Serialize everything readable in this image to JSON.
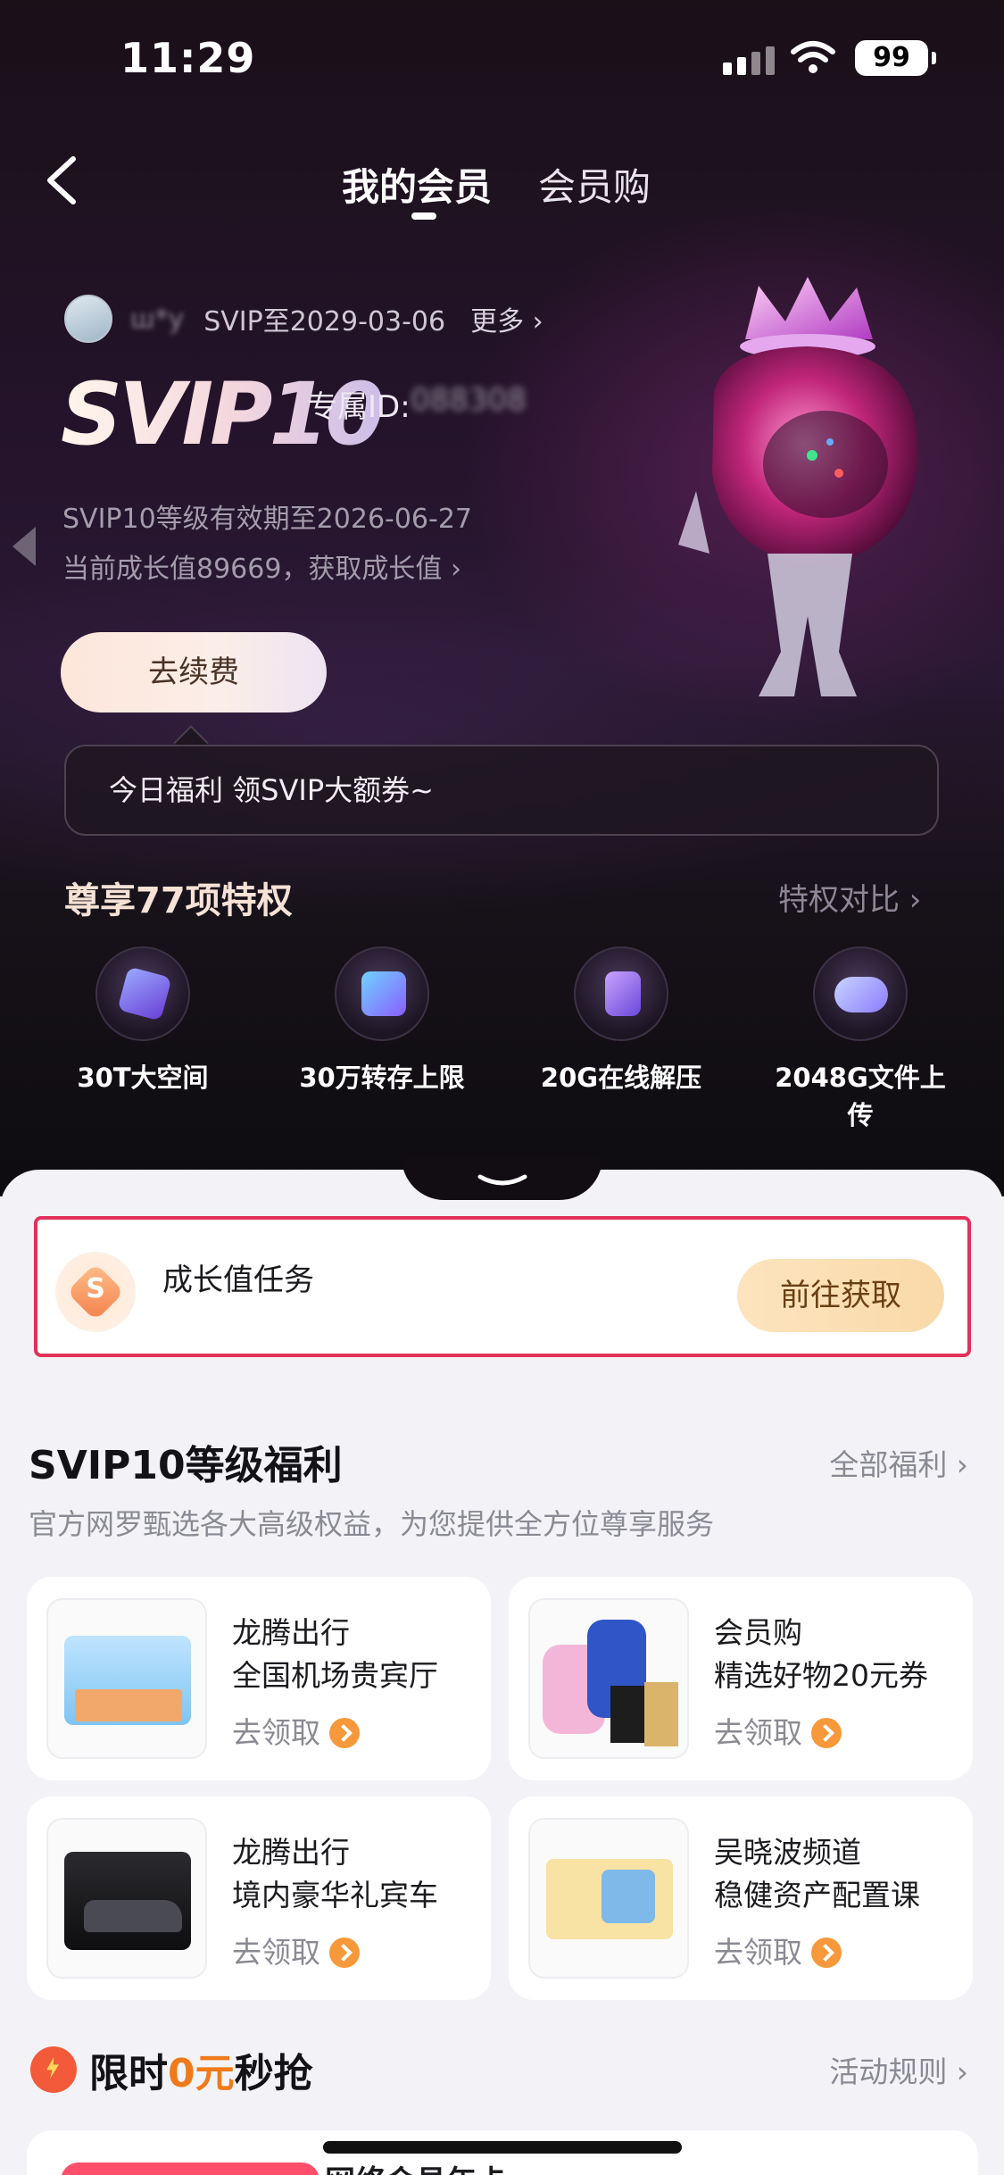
{
  "status": {
    "time": "11:29",
    "battery": "99"
  },
  "nav": {
    "tab_active": "我的会员",
    "tab_other": "会员购"
  },
  "user": {
    "name": "ш*y",
    "level_expire": "SVIP至2029-03-06",
    "more": "更多"
  },
  "level": {
    "badge": "SVIP10",
    "exclusive_label": "专属ID:",
    "exclusive_id": "088308",
    "validity": "SVIP10等级有效期至2026-06-27",
    "growth": "当前成长值89669，获取成长值"
  },
  "renew_button": "去续费",
  "tip": "今日福利 领SVIP大额券~",
  "privileges": {
    "title": "尊享77项特权",
    "compare": "特权对比",
    "items": [
      {
        "label": "30T大空间",
        "icon": "cube-storage-icon"
      },
      {
        "label": "30万转存上限",
        "icon": "folder-transfer-icon"
      },
      {
        "label": "20G在线解压",
        "icon": "zip-file-icon"
      },
      {
        "label": "2048G文件上传",
        "icon": "cloud-upload-icon"
      }
    ]
  },
  "task": {
    "title": "成长值任务",
    "button": "前往获取"
  },
  "benefits": {
    "title": "SVIP10等级福利",
    "all_link": "全部福利",
    "desc": "官方网罗甄选各大高级权益，为您提供全方位尊享服务",
    "cards": [
      {
        "line1": "龙腾出行",
        "line2": "全国机场贵宾厅",
        "action": "去领取"
      },
      {
        "line1": "会员购",
        "line2": "精选好物20元券",
        "action": "去领取"
      },
      {
        "line1": "龙腾出行",
        "line2": "境内豪华礼宾车",
        "action": "去领取"
      },
      {
        "line1": "吴晓波频道",
        "line2": "稳健资产配置课",
        "action": "去领取"
      }
    ]
  },
  "flash": {
    "pre": "限时",
    "zero": "0元",
    "post": "秒抢",
    "rules": "活动规则"
  },
  "next_card_title": "网络会员年卡",
  "colors": {
    "accent_red": "#e2315a",
    "orange": "#f7993a",
    "gold_btn": "#fde4bf"
  }
}
